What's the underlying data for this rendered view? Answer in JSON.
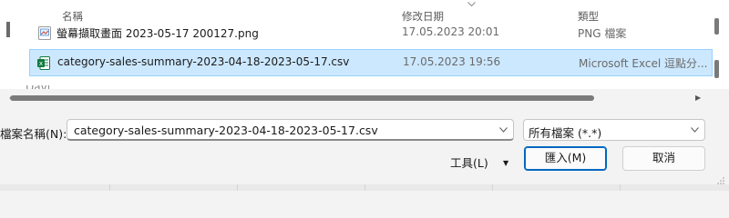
{
  "columns": {
    "name": "名稱",
    "modified": "修改日期",
    "type": "類型"
  },
  "files": [
    {
      "icon": "png-file-icon",
      "name": "螢幕擷取畫面 2023-05-17 200127.png",
      "modified": "17.05.2023 20:01",
      "type": "PNG 檔案",
      "selected": false
    },
    {
      "icon": "excel-csv-icon",
      "name": "category-sales-summary-2023-04-18-2023-05-17.csv",
      "modified": "17.05.2023 19:56",
      "type": "Microsoft Excel 逗點分...",
      "selected": true
    }
  ],
  "cut_off_row": "Davi",
  "file_name": {
    "label": "檔案名稱(N):",
    "value": "category-sales-summary-2023-04-18-2023-05-17.csv"
  },
  "filter": {
    "value": "所有檔案 (*.*)"
  },
  "tools": {
    "label": "工具(L)"
  },
  "buttons": {
    "open": "匯入(M)",
    "cancel": "取消"
  },
  "colors": {
    "selection_bg": "#cce8ff",
    "selection_border": "#99d1ff",
    "accent": "#0067c0",
    "excel_green": "#107c41"
  }
}
